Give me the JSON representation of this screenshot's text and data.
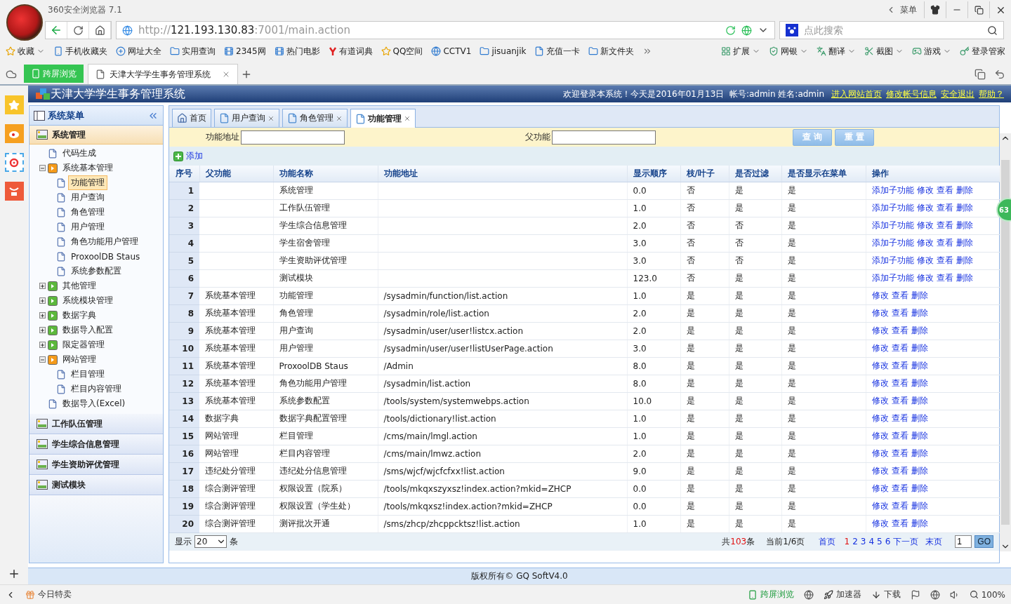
{
  "browser": {
    "title": "360安全浏览器 7.1",
    "menu_label": "菜单",
    "url": {
      "scheme": "http://",
      "host": "121.193.130.83",
      "rest": ":7001/main.action"
    },
    "search_placeholder": "点此搜索",
    "bookmarks": [
      "收藏",
      "手机收藏夹",
      "网址大全",
      "实用查询",
      "2345网",
      "热门电影",
      "有道词典",
      "QQ空间",
      "CCTV1",
      "jisuanjik",
      "充值一卡",
      "新文件夹"
    ],
    "tools": [
      "扩展",
      "网银",
      "翻译",
      "截图",
      "游戏",
      "登录管家"
    ],
    "cross_screen": "跨屏浏览",
    "tab_title": "天津大学学生事务管理系统"
  },
  "app": {
    "title": "天津大学学生事务管理系统",
    "welcome": "欢迎登录本系统！今天是2016年01月13日  帐号:admin 姓名:admin",
    "header_links": [
      "进入网站首页",
      "修改帐号信息",
      "安全退出",
      "帮助？"
    ],
    "footer": "版权所有© GQ SoftV4.0"
  },
  "sidebar": {
    "title": "系统菜单",
    "sections": [
      {
        "label": "系统管理",
        "expanded": true,
        "tree": [
          {
            "label": "代码生成",
            "selected": false
          },
          {
            "label": "系统基本管理",
            "expanded": true,
            "children": [
              {
                "label": "功能管理",
                "selected": true
              },
              {
                "label": "用户查询",
                "selected": false
              },
              {
                "label": "角色管理",
                "selected": false
              },
              {
                "label": "用户管理",
                "selected": false
              },
              {
                "label": "角色功能用户管理",
                "selected": false
              },
              {
                "label": "ProxoolDB Staus",
                "selected": false
              },
              {
                "label": "系统参数配置",
                "selected": false
              }
            ]
          },
          {
            "label": "其他管理",
            "expanded": false
          },
          {
            "label": "系统模块管理",
            "expanded": false
          },
          {
            "label": "数据字典",
            "expanded": false
          },
          {
            "label": "数据导入配置",
            "expanded": false
          },
          {
            "label": "限定器管理",
            "expanded": false
          },
          {
            "label": "网站管理",
            "expanded": true,
            "children": [
              {
                "label": "栏目管理",
                "selected": false
              },
              {
                "label": "栏目内容管理",
                "selected": false
              }
            ]
          },
          {
            "label": "数据导入(Excel)",
            "selected": false
          }
        ]
      },
      {
        "label": "工作队伍管理",
        "expanded": false
      },
      {
        "label": "学生综合信息管理",
        "expanded": false
      },
      {
        "label": "学生资助评优管理",
        "expanded": false
      },
      {
        "label": "测试模块",
        "expanded": false
      }
    ]
  },
  "tabs": [
    {
      "label": "首页",
      "kind": "home",
      "selected": false
    },
    {
      "label": "用户查询",
      "kind": "page",
      "selected": false
    },
    {
      "label": "角色管理",
      "kind": "page",
      "selected": false
    },
    {
      "label": "功能管理",
      "kind": "page",
      "selected": true
    }
  ],
  "filters": [
    {
      "label": "功能地址"
    },
    {
      "label": "父功能"
    }
  ],
  "filter_buttons": [
    "查 询",
    "重 置"
  ],
  "add_label": "添加",
  "table": {
    "columns": [
      "序号",
      "父功能",
      "功能名称",
      "功能地址",
      "显示顺序",
      "枝/叶子",
      "是否过滤",
      "是否显示在菜单",
      "操作"
    ],
    "rows": [
      {
        "no": "1",
        "name": "系统管理",
        "order": "0.0",
        "leaf": "否",
        "filter": "是",
        "menu": "是",
        "actions": [
          "添加子功能",
          "修改",
          "查看",
          "删除"
        ]
      },
      {
        "no": "2",
        "name": "工作队伍管理",
        "order": "1.0",
        "leaf": "否",
        "filter": "是",
        "menu": "是",
        "actions": [
          "添加子功能",
          "修改",
          "查看",
          "删除"
        ]
      },
      {
        "no": "3",
        "name": "学生综合信息管理",
        "order": "2.0",
        "leaf": "否",
        "filter": "否",
        "menu": "是",
        "actions": [
          "添加子功能",
          "修改",
          "查看",
          "删除"
        ]
      },
      {
        "no": "4",
        "name": "学生宿舍管理",
        "order": "3.0",
        "leaf": "否",
        "filter": "否",
        "menu": "是",
        "actions": [
          "添加子功能",
          "修改",
          "查看",
          "删除"
        ]
      },
      {
        "no": "5",
        "name": "学生资助评优管理",
        "order": "3.0",
        "leaf": "否",
        "filter": "否",
        "menu": "是",
        "actions": [
          "添加子功能",
          "修改",
          "查看",
          "删除"
        ]
      },
      {
        "no": "6",
        "name": "测试模块",
        "order": "123.0",
        "leaf": "否",
        "filter": "是",
        "menu": "是",
        "actions": [
          "添加子功能",
          "修改",
          "查看",
          "删除"
        ]
      },
      {
        "no": "7",
        "parent": "系统基本管理",
        "name": "功能管理",
        "path": "/sysadmin/function/list.action",
        "order": "1.0",
        "leaf": "是",
        "filter": "是",
        "menu": "是",
        "actions": [
          "修改",
          "查看",
          "删除"
        ]
      },
      {
        "no": "8",
        "parent": "系统基本管理",
        "name": "角色管理",
        "path": "/sysadmin/role/list.action",
        "order": "2.0",
        "leaf": "是",
        "filter": "是",
        "menu": "是",
        "actions": [
          "修改",
          "查看",
          "删除"
        ]
      },
      {
        "no": "9",
        "parent": "系统基本管理",
        "name": "用户查询",
        "path": "/sysadmin/user/user!listcx.action",
        "order": "2.0",
        "leaf": "是",
        "filter": "是",
        "menu": "是",
        "actions": [
          "修改",
          "查看",
          "删除"
        ]
      },
      {
        "no": "10",
        "parent": "系统基本管理",
        "name": "用户管理",
        "path": "/sysadmin/user/user!listUserPage.action",
        "order": "3.0",
        "leaf": "是",
        "filter": "是",
        "menu": "是",
        "actions": [
          "修改",
          "查看",
          "删除"
        ]
      },
      {
        "no": "11",
        "parent": "系统基本管理",
        "name": "ProxoolDB Staus",
        "path": "/Admin",
        "order": "8.0",
        "leaf": "是",
        "filter": "是",
        "menu": "是",
        "actions": [
          "修改",
          "查看",
          "删除"
        ]
      },
      {
        "no": "12",
        "parent": "系统基本管理",
        "name": "角色功能用户管理",
        "path": "/sysadmin/list.action",
        "order": "8.0",
        "leaf": "是",
        "filter": "是",
        "menu": "是",
        "actions": [
          "修改",
          "查看",
          "删除"
        ]
      },
      {
        "no": "13",
        "parent": "系统基本管理",
        "name": "系统参数配置",
        "path": "/tools/system/systemwebps.action",
        "order": "10.0",
        "leaf": "是",
        "filter": "是",
        "menu": "是",
        "actions": [
          "修改",
          "查看",
          "删除"
        ]
      },
      {
        "no": "14",
        "parent": "数据字典",
        "name": "数据字典配置管理",
        "path": "/tools/dictionary!list.action",
        "order": "1.0",
        "leaf": "是",
        "filter": "是",
        "menu": "是",
        "actions": [
          "修改",
          "查看",
          "删除"
        ]
      },
      {
        "no": "15",
        "parent": "网站管理",
        "name": "栏目管理",
        "path": "/cms/main/lmgl.action",
        "order": "1.0",
        "leaf": "是",
        "filter": "是",
        "menu": "是",
        "actions": [
          "修改",
          "查看",
          "删除"
        ]
      },
      {
        "no": "16",
        "parent": "网站管理",
        "name": "栏目内容管理",
        "path": "/cms/main/lmwz.action",
        "order": "2.0",
        "leaf": "是",
        "filter": "是",
        "menu": "是",
        "actions": [
          "修改",
          "查看",
          "删除"
        ]
      },
      {
        "no": "17",
        "parent": "违纪处分管理",
        "name": "违纪处分信息管理",
        "path": "/sms/wjcf/wjcfcfxx!list.action",
        "order": "9.0",
        "leaf": "是",
        "filter": "是",
        "menu": "是",
        "actions": [
          "修改",
          "查看",
          "删除"
        ]
      },
      {
        "no": "18",
        "parent": "综合测评管理",
        "name": "权限设置（院系）",
        "path": "/tools/mkqxszyxsz!index.action?mkid=ZHCP",
        "order": "0.0",
        "leaf": "是",
        "filter": "是",
        "menu": "是",
        "actions": [
          "修改",
          "查看",
          "删除"
        ]
      },
      {
        "no": "19",
        "parent": "综合测评管理",
        "name": "权限设置（学生处）",
        "path": "/tools/mkqxsz!index.action?mkid=ZHCP",
        "order": "0.0",
        "leaf": "是",
        "filter": "是",
        "menu": "是",
        "actions": [
          "修改",
          "查看",
          "删除"
        ]
      },
      {
        "no": "20",
        "parent": "综合测评管理",
        "name": "测评批次开通",
        "path": "/sms/zhcp/zhcppcktsz!list.action",
        "order": "1.0",
        "leaf": "是",
        "filter": "是",
        "menu": "是",
        "actions": [
          "修改",
          "查看",
          "删除"
        ]
      }
    ]
  },
  "pagination": {
    "show_label": "显示",
    "page_size": "20",
    "unit": "条",
    "total_prefix": "共",
    "total": "103",
    "total_suffix": "条",
    "current": "当前1/6页",
    "first": "首页",
    "pages": [
      {
        "label": "1",
        "selected": true
      },
      {
        "label": "2",
        "selected": false
      },
      {
        "label": "3",
        "selected": false
      },
      {
        "label": "4",
        "selected": false
      },
      {
        "label": "5",
        "selected": false
      },
      {
        "label": "6",
        "selected": false
      }
    ],
    "next": "下一页",
    "last": "末页",
    "goto_value": "1",
    "go": "GO"
  },
  "float_badge": "63",
  "status_bar": {
    "deals": "今日特卖",
    "cross_screen": "跨屏浏览",
    "accelerator": "加速器",
    "download": "下载",
    "zoom": "100%"
  }
}
